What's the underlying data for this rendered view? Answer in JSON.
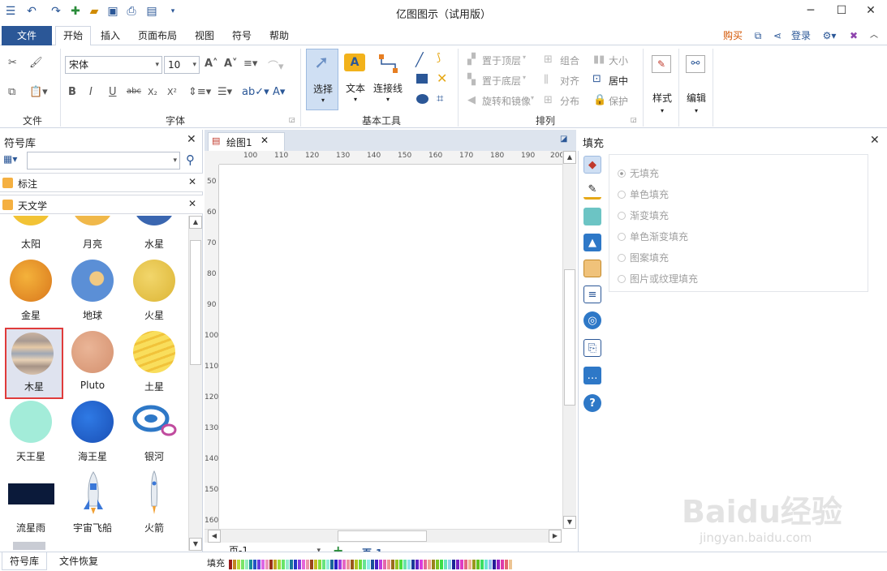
{
  "app": {
    "title": "亿图图示（试用版）"
  },
  "menu": {
    "file": "文件",
    "tabs": [
      "开始",
      "插入",
      "页面布局",
      "视图",
      "符号",
      "帮助"
    ],
    "buy": "购买",
    "login": "登录"
  },
  "ribbon": {
    "groups": {
      "file": "文件",
      "font": "字体",
      "basic_tools": "基本工具",
      "arrange": "排列"
    },
    "font_name": "宋体",
    "font_size": "10",
    "select": "选择",
    "text": "文本",
    "connector": "连接线",
    "bring_to_top": "置于顶层",
    "send_to_bottom": "置于底层",
    "rotate_mirror": "旋转和镜像",
    "group": "组合",
    "align": "对齐",
    "distribute": "分布",
    "size": "大小",
    "center": "居中",
    "protect": "保护",
    "style": "样式",
    "edit": "编辑"
  },
  "library": {
    "title": "符号库",
    "search_placeholder": "",
    "sections": [
      "标注",
      "天文学"
    ],
    "symbols": [
      {
        "label": "太阳",
        "color": "#f2c335"
      },
      {
        "label": "月亮",
        "color": "#f0b84a"
      },
      {
        "label": "水星",
        "color": "#3a66b0"
      },
      {
        "label": "金星",
        "color": "#e39a2a"
      },
      {
        "label": "地球",
        "color": "#5b8fd6"
      },
      {
        "label": "火星",
        "color": "#e8c446"
      },
      {
        "label": "木星",
        "color": "#c8a88c",
        "selected": true
      },
      {
        "label": "Pluto",
        "color": "#e0a583"
      },
      {
        "label": "土星",
        "color": "#f7d34e"
      },
      {
        "label": "天王星",
        "color": "#a3ecd9"
      },
      {
        "label": "海王星",
        "color": "#1c5fd0"
      },
      {
        "label": "银河",
        "color": "#2e78c7"
      },
      {
        "label": "流星雨",
        "color": "#0b1a3a"
      },
      {
        "label": "宇宙飞船",
        "color": "#d0d8e4"
      },
      {
        "label": "火箭",
        "color": "#d7dfe8"
      }
    ]
  },
  "document": {
    "tab": "绘图1",
    "ruler_h": [
      "100",
      "110",
      "120",
      "130",
      "140",
      "150",
      "160",
      "170",
      "180",
      "190",
      "200"
    ],
    "ruler_v": [
      "50",
      "60",
      "70",
      "80",
      "90",
      "100",
      "110",
      "120",
      "130",
      "140",
      "150",
      "160"
    ]
  },
  "fill": {
    "title": "填充",
    "options": [
      "无填充",
      "单色填充",
      "渐变填充",
      "单色渐变填充",
      "图案填充",
      "图片或纹理填充"
    ]
  },
  "bottom": {
    "tabs": [
      "符号库",
      "文件恢复"
    ],
    "page_select": "页-1",
    "page_tab": "页-1",
    "fill_label": "填充"
  },
  "watermark": {
    "main": "Baidu经验",
    "sub": "jingyan.baidu.com"
  }
}
